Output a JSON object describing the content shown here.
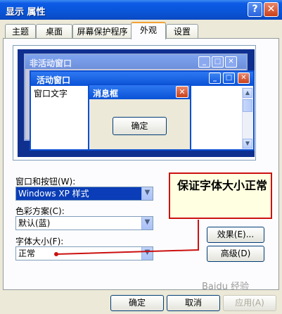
{
  "window": {
    "title": "显示 属性",
    "help_icon": "?",
    "close_icon": "✕"
  },
  "tabs": [
    {
      "label": "主题",
      "active": false
    },
    {
      "label": "桌面",
      "active": false
    },
    {
      "label": "屏幕保护程序",
      "active": false
    },
    {
      "label": "外观",
      "active": true
    },
    {
      "label": "设置",
      "active": false
    }
  ],
  "preview": {
    "inactive_window_title": "非活动窗口",
    "active_window_title": "活动窗口",
    "window_text": "窗口文字",
    "message_box_title": "消息框",
    "message_box_ok": "确定"
  },
  "controls": {
    "windows_buttons_label": "窗口和按钮(W):",
    "windows_buttons_value": "Windows XP 样式",
    "color_scheme_label": "色彩方案(C):",
    "color_scheme_value": "默认(蓝)",
    "font_size_label": "字体大小(F):",
    "font_size_value": "正常",
    "effects_button": "效果(E)...",
    "advanced_button": "高级(D)"
  },
  "annotation": {
    "text": "保证字体大小正常",
    "color": "#cc1111"
  },
  "footer": {
    "ok": "确定",
    "cancel": "取消",
    "apply": "应用(A)"
  },
  "watermark": "Baidu 经验",
  "colors": {
    "titlebar": "#0a55d8",
    "dialog_bg": "#ece9d8",
    "desktop": "#103090"
  }
}
